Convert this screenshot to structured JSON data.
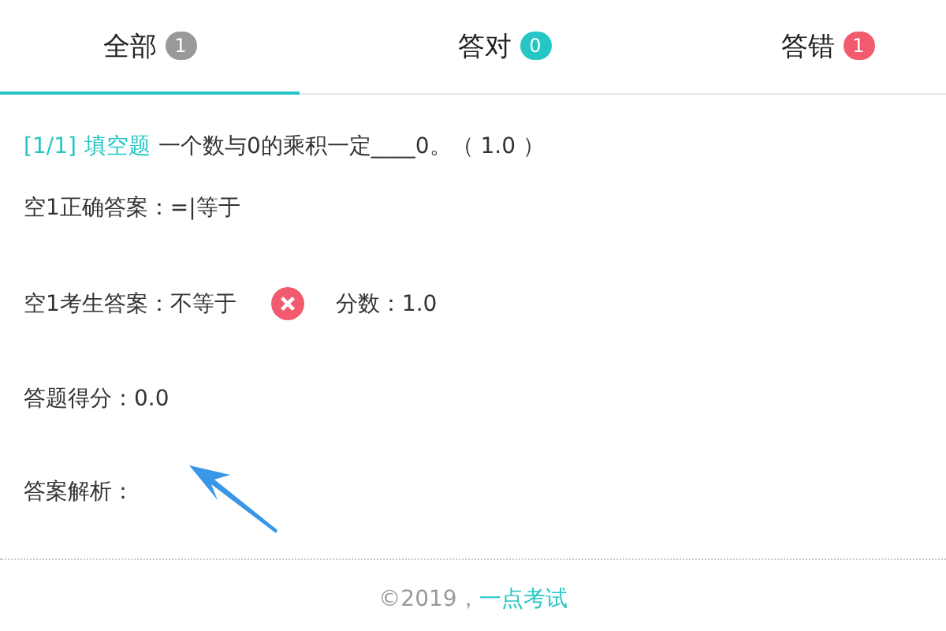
{
  "tabs": [
    {
      "label": "全部",
      "count": "1",
      "color": "#999999",
      "selected": true
    },
    {
      "label": "答对",
      "count": "0",
      "color": "#26c6c6",
      "selected": false
    },
    {
      "label": "答错",
      "count": "1",
      "color": "#f25a6e",
      "selected": false
    }
  ],
  "question": {
    "index": "[1/1]",
    "type": "填空题",
    "text": "一个数与0的乘积一定____0。（ 1.0 ）"
  },
  "correct_answer": "空1正确答案：=|等于",
  "student_answer": {
    "text": "空1考生答案：不等于",
    "correct": false,
    "score": "分数：1.0"
  },
  "total_score": "答题得分：0.0",
  "analysis": "答案解析：",
  "footer": {
    "copyright": "©2019，",
    "link": "一点考试"
  }
}
